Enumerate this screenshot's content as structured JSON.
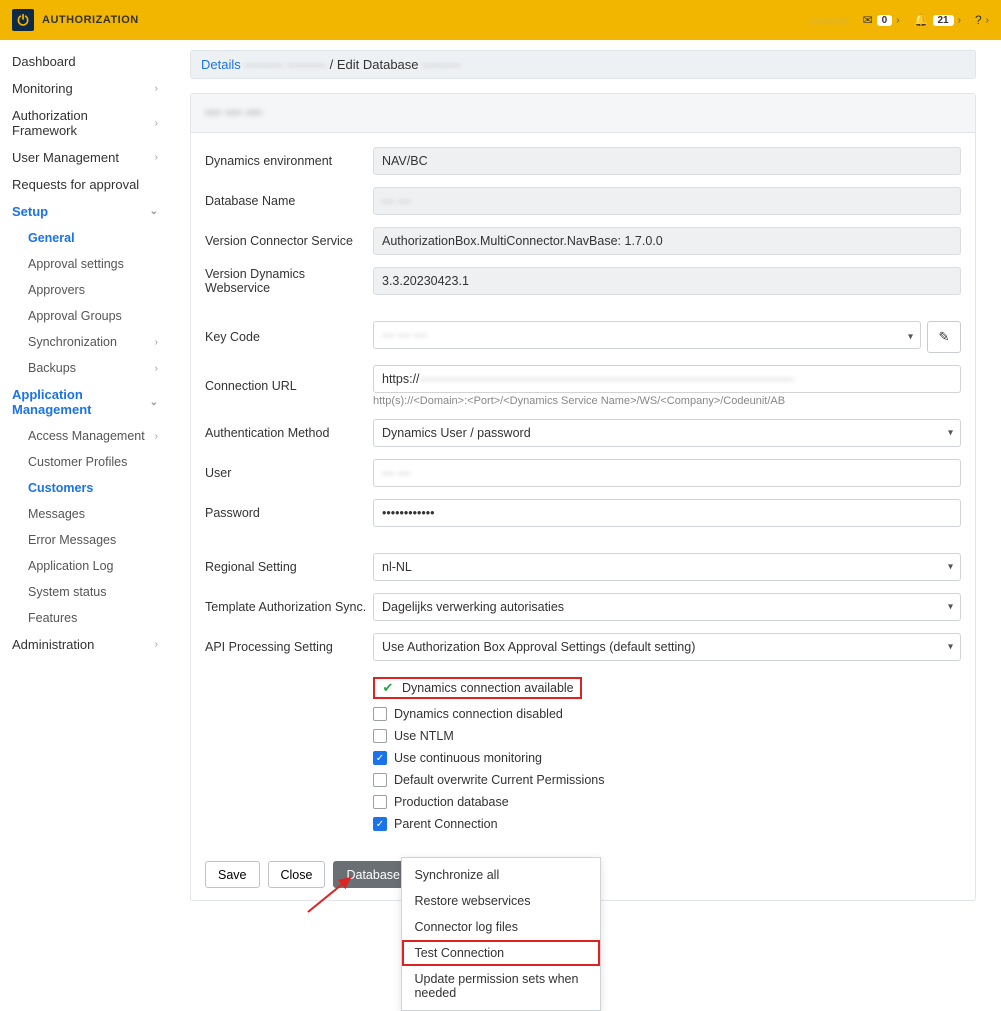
{
  "brand": "AUTHORIZATION",
  "topbar": {
    "mail_count": "0",
    "bell_count": "21",
    "help": "?"
  },
  "sidebar": {
    "dashboard": "Dashboard",
    "monitoring": "Monitoring",
    "auth_framework": "Authorization Framework",
    "user_mgmt": "User Management",
    "requests": "Requests for approval",
    "setup": "Setup",
    "general": "General",
    "approval_settings": "Approval settings",
    "approvers": "Approvers",
    "approval_groups": "Approval Groups",
    "synchronization": "Synchronization",
    "backups": "Backups",
    "app_mgmt": "Application Management",
    "access_mgmt": "Access Management",
    "customer_profiles": "Customer Profiles",
    "customers": "Customers",
    "messages": "Messages",
    "error_messages": "Error Messages",
    "app_log": "Application Log",
    "system_status": "System status",
    "features": "Features",
    "administration": "Administration"
  },
  "breadcrumb": {
    "details": "Details",
    "sep": " / ",
    "edit_db": "Edit Database"
  },
  "form": {
    "header_title": "— — —",
    "dyn_env": {
      "label": "Dynamics environment",
      "value": "NAV/BC"
    },
    "db_name": {
      "label": "Database Name",
      "value": "— —"
    },
    "ver_conn": {
      "label": "Version Connector Service",
      "value": "AuthorizationBox.MultiConnector.NavBase: 1.7.0.0"
    },
    "ver_dynws": {
      "label": "Version Dynamics Webservice",
      "value": "3.3.20230423.1"
    },
    "keycode": {
      "label": "Key Code",
      "value": "— — —"
    },
    "conn_url": {
      "label": "Connection URL",
      "value": "https://",
      "hint": "http(s)://<Domain>:<Port>/<Dynamics Service Name>/WS/<Company>/Codeunit/AB"
    },
    "auth_method": {
      "label": "Authentication Method",
      "value": "Dynamics User / password"
    },
    "user": {
      "label": "User",
      "value": "— —"
    },
    "password": {
      "label": "Password",
      "value": "••••••••••••"
    },
    "regional": {
      "label": "Regional Setting",
      "value": "nl-NL"
    },
    "template_sync": {
      "label": "Template Authorization Sync.",
      "value": "Dagelijks verwerking autorisaties"
    },
    "api_proc": {
      "label": "API Processing Setting",
      "value": "Use Authorization Box Approval Settings (default setting)"
    }
  },
  "checks": {
    "conn_avail": "Dynamics connection available",
    "conn_disabled": "Dynamics connection disabled",
    "use_ntlm": "Use NTLM",
    "cont_mon": "Use continuous monitoring",
    "overwrite": "Default overwrite Current Permissions",
    "prod_db": "Production database",
    "parent_conn": "Parent Connection"
  },
  "buttons": {
    "save": "Save",
    "close": "Close",
    "database": "Database"
  },
  "dropdown": {
    "sync_all": "Synchronize all",
    "restore_ws": "Restore webservices",
    "conn_logs": "Connector log files",
    "test_conn": "Test Connection",
    "update_perm": "Update permission sets when needed"
  }
}
